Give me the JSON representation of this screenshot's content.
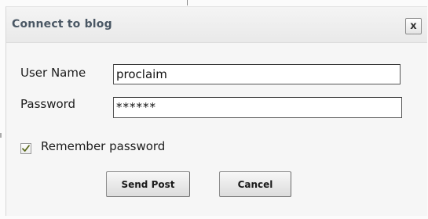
{
  "dialog": {
    "title": "Connect to blog",
    "close_label": "x"
  },
  "form": {
    "username_label": "User Name",
    "username_value": "proclaim",
    "password_label": "Password",
    "password_value": "******",
    "remember_label": "Remember password",
    "remember_checked": true
  },
  "buttons": {
    "send_label": "Send Post",
    "cancel_label": "Cancel"
  }
}
